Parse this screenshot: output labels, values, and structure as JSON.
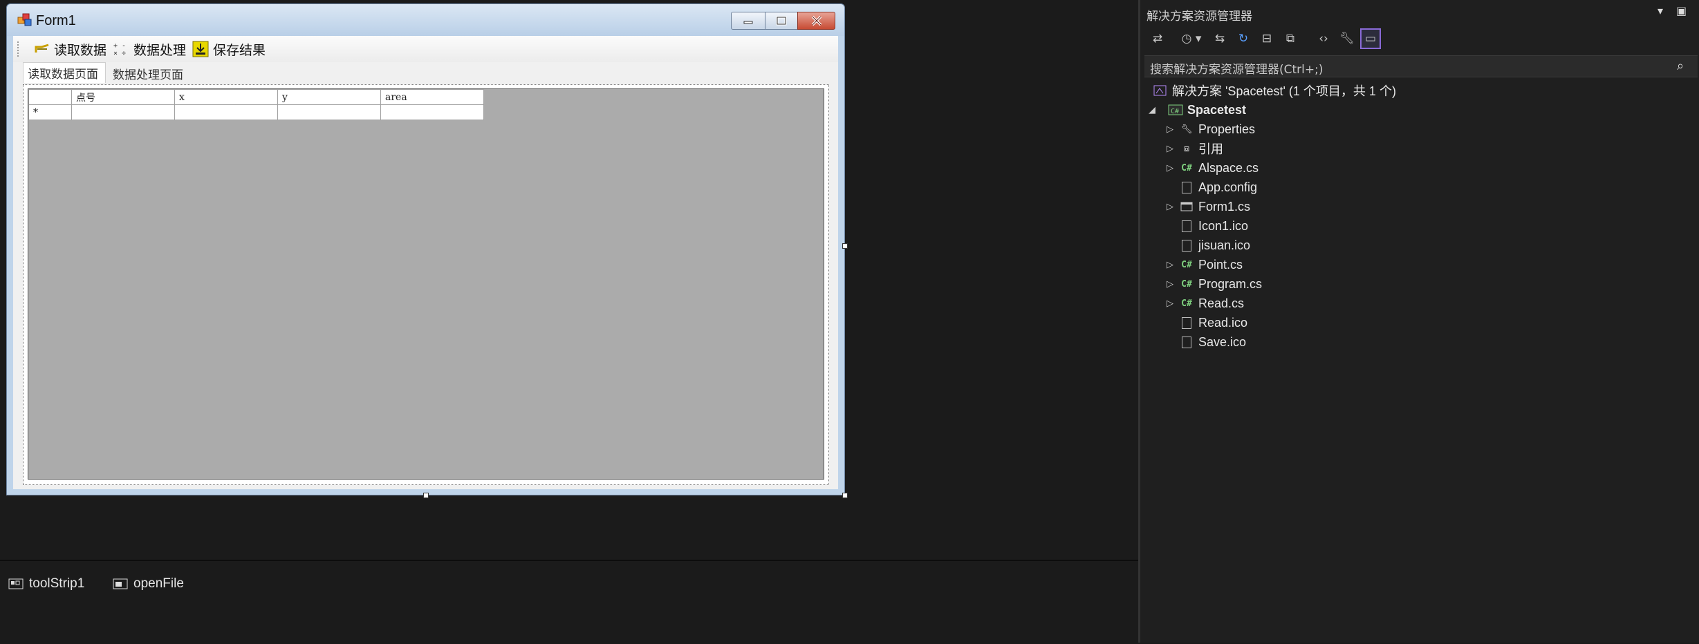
{
  "form": {
    "title": "Form1",
    "toolstrip": {
      "read_label": "读取数据",
      "process_label": "数据处理",
      "save_label": "保存结果"
    },
    "tabs": [
      {
        "label": "读取数据页面"
      },
      {
        "label": "数据处理页面"
      }
    ],
    "grid": {
      "columns": [
        "点号",
        "x",
        "y",
        "area"
      ],
      "new_row_marker": "*"
    }
  },
  "tray": {
    "items": [
      {
        "label": "toolStrip1"
      },
      {
        "label": "openFile"
      }
    ]
  },
  "explorer": {
    "title": "解决方案资源管理器",
    "search_placeholder": "搜索解决方案资源管理器(Ctrl+;)",
    "solution_label": "解决方案 'Spacetest' (1 个项目，共 1 个)",
    "project_label": "Spacetest",
    "items": [
      {
        "label": "Properties",
        "icon": "wrench-icon"
      },
      {
        "label": "引用",
        "icon": "references-icon"
      },
      {
        "label": "Alspace.cs",
        "icon": "csharp-icon"
      },
      {
        "label": "App.config",
        "icon": "config-icon"
      },
      {
        "label": "Form1.cs",
        "icon": "form-icon"
      },
      {
        "label": "Icon1.ico",
        "icon": "image-file-icon"
      },
      {
        "label": "jisuan.ico",
        "icon": "image-file-icon"
      },
      {
        "label": "Point.cs",
        "icon": "csharp-icon"
      },
      {
        "label": "Program.cs",
        "icon": "csharp-icon"
      },
      {
        "label": "Read.cs",
        "icon": "csharp-icon"
      },
      {
        "label": "Read.ico",
        "icon": "image-file-icon"
      },
      {
        "label": "Save.ico",
        "icon": "image-file-icon"
      }
    ]
  },
  "colors": {
    "vs_background": "#1b1b1b",
    "grid_background": "#ababab",
    "csharp_green": "#7fd17f",
    "active_toolbar_border": "#8a6bd8"
  }
}
